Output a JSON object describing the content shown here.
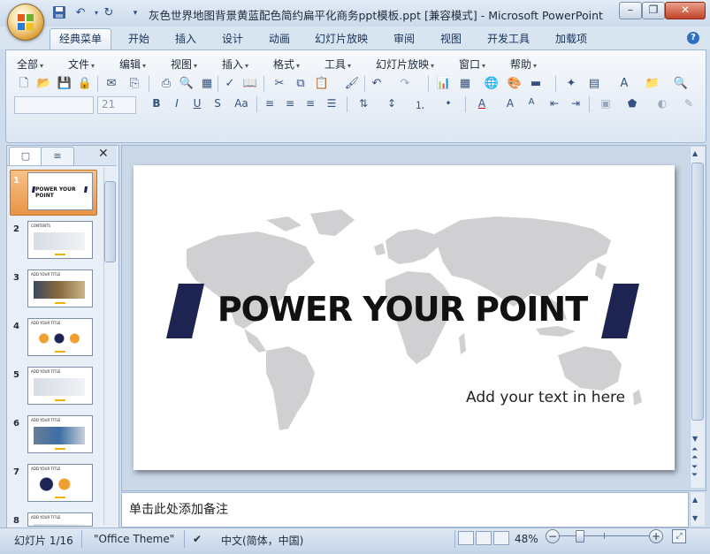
{
  "window": {
    "title": "灰色世界地图背景黄蓝配色简约扁平化商务ppt模板.ppt [兼容模式] - Microsoft PowerPoint",
    "qa_dropdown": "▾"
  },
  "ribbon_tabs": [
    "经典菜单",
    "开始",
    "插入",
    "设计",
    "动画",
    "幻灯片放映",
    "审阅",
    "视图",
    "开发工具",
    "加载项"
  ],
  "classic_menu": [
    "全部",
    "文件",
    "编辑",
    "视图",
    "插入",
    "格式",
    "工具",
    "幻灯片放映",
    "窗口",
    "帮助"
  ],
  "font_size": "21",
  "format_buttons": [
    "B",
    "I",
    "U",
    "S",
    "Aa"
  ],
  "pane_tabs": [
    "▢",
    "≡"
  ],
  "thumbnails": [
    {
      "num": "1",
      "title": "POWER YOUR POINT"
    },
    {
      "num": "2",
      "title": "CONTENTS"
    },
    {
      "num": "3",
      "title": "ADD YOUR TITLE"
    },
    {
      "num": "4",
      "title": "ADD YOUR TITLE"
    },
    {
      "num": "5",
      "title": "ADD YOUR TITLE"
    },
    {
      "num": "6",
      "title": "ADD YOUR TITLE"
    },
    {
      "num": "7",
      "title": "ADD YOUR TITLE"
    },
    {
      "num": "8",
      "title": "ADD YOUR TITLE"
    }
  ],
  "slide": {
    "title": "POWER YOUR POINT",
    "subtitle": "Add your text in here",
    "accent_color": "#1e2452"
  },
  "notes": {
    "placeholder": "单击此处添加备注"
  },
  "status": {
    "slide": "幻灯片 1/16",
    "theme": "\"Office Theme\"",
    "language": "中文(简体，中国)",
    "zoom": "48%",
    "zoom_minus": "−",
    "zoom_plus": "+"
  }
}
